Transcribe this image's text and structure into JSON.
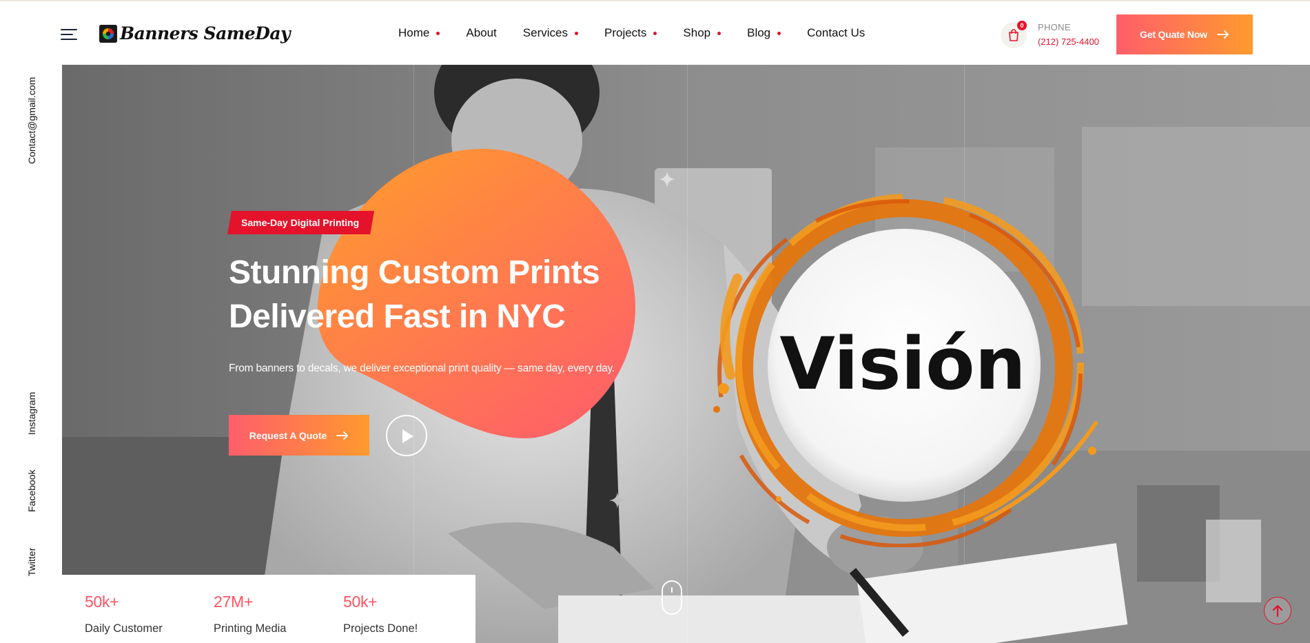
{
  "header": {
    "logo_text": "Banners SameDay",
    "nav": [
      {
        "label": "Home",
        "has_dropdown": true
      },
      {
        "label": "About",
        "has_dropdown": false
      },
      {
        "label": "Services",
        "has_dropdown": true
      },
      {
        "label": "Projects",
        "has_dropdown": true
      },
      {
        "label": "Shop",
        "has_dropdown": true
      },
      {
        "label": "Blog",
        "has_dropdown": true
      },
      {
        "label": "Contact Us",
        "has_dropdown": false
      }
    ],
    "cart_count": "0",
    "phone_label": "PHONE",
    "phone_number": "(212) 725-4400",
    "cta_label": "Get Quate Now"
  },
  "rail": {
    "email": "Contact@gmail.com",
    "social": [
      "Instagram",
      "Facebook",
      "Twitter"
    ]
  },
  "hero": {
    "badge": "Same-Day Digital Printing",
    "title_line1": "Stunning Custom Prints",
    "title_line2": "Delivered Fast in NYC",
    "subtitle": "From banners to decals, we deliver exceptional print quality — same day, every day.",
    "cta_label": "Request A Quote",
    "vision_text": "Visión"
  },
  "stats": [
    {
      "value": "50k+",
      "label": "Daily Customer"
    },
    {
      "value": "27M+",
      "label": "Printing Media"
    },
    {
      "value": "50k+",
      "label": "Projects Done!"
    }
  ],
  "colors": {
    "accent_red": "#e4132b",
    "gradient_start": "#ff5e6a",
    "gradient_end": "#ff9a2e",
    "stat_value": "#ff5363"
  }
}
